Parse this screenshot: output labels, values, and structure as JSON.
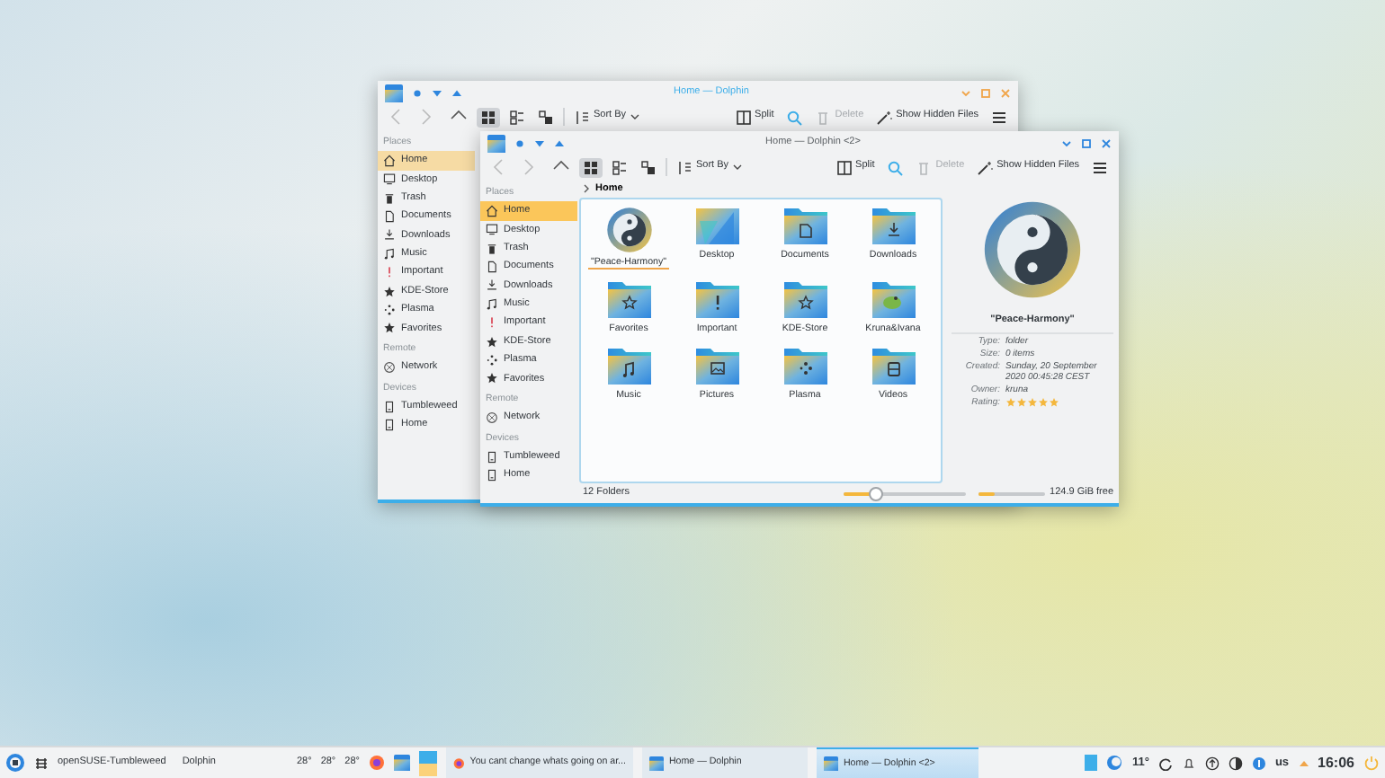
{
  "back_window": {
    "title": "Home — Dolphin",
    "toolbar": {
      "nav": [
        {
          "disabled": true
        },
        {
          "disabled": true
        },
        {
          "disabled": false
        }
      ],
      "view_modes": [
        {
          "selected": true
        },
        {
          "selected": false
        },
        {
          "selected": false
        }
      ],
      "sort": "Sort By",
      "split": "Split",
      "delete": {
        "label": "Delete",
        "disabled": true
      },
      "hidden_files": "Show Hidden Files"
    },
    "sidebar": [
      {
        "heading": "Places",
        "items": [
          {
            "label": "Home",
            "selected": true
          },
          {
            "label": "Desktop",
            "selected": false
          },
          {
            "label": "Trash",
            "selected": false
          },
          {
            "label": "Documents",
            "selected": false
          },
          {
            "label": "Downloads",
            "selected": false
          },
          {
            "label": "Music",
            "selected": false
          },
          {
            "label": "Important",
            "selected": false
          },
          {
            "label": "KDE-Store",
            "selected": false
          },
          {
            "label": "Plasma",
            "selected": false
          },
          {
            "label": "Favorites",
            "selected": false
          }
        ]
      },
      {
        "heading": "Remote",
        "items": [
          {
            "label": "Network",
            "selected": false
          }
        ]
      },
      {
        "heading": "Devices",
        "items": [
          {
            "label": "Tumbleweed",
            "selected": false
          },
          {
            "label": "Home",
            "selected": false
          }
        ]
      }
    ]
  },
  "front_window": {
    "title": "Home — Dolphin <2>",
    "toolbar": {
      "nav": [
        {
          "disabled": true
        },
        {
          "disabled": true
        },
        {
          "disabled": false
        }
      ],
      "view_modes": [
        {
          "selected": true
        },
        {
          "selected": false
        },
        {
          "selected": false
        }
      ],
      "sort": "Sort By",
      "split": "Split",
      "delete": {
        "label": "Delete",
        "disabled": true
      },
      "hidden_files": "Show Hidden Files"
    },
    "sidebar": [
      {
        "heading": "Places",
        "items": [
          {
            "label": "Home",
            "selected": true
          },
          {
            "label": "Desktop",
            "selected": false
          },
          {
            "label": "Trash",
            "selected": false
          },
          {
            "label": "Documents",
            "selected": false
          },
          {
            "label": "Downloads",
            "selected": false
          },
          {
            "label": "Music",
            "selected": false
          },
          {
            "label": "Important",
            "selected": false
          },
          {
            "label": "KDE-Store",
            "selected": false
          },
          {
            "label": "Plasma",
            "selected": false
          },
          {
            "label": "Favorites",
            "selected": false
          }
        ]
      },
      {
        "heading": "Remote",
        "items": [
          {
            "label": "Network",
            "selected": false
          }
        ]
      },
      {
        "heading": "Devices",
        "items": [
          {
            "label": "Tumbleweed",
            "selected": false
          },
          {
            "label": "Home",
            "selected": false
          }
        ]
      }
    ],
    "breadcrumb": "Home",
    "items": [
      {
        "label": "\"Peace-Harmony\"",
        "kind": "emblem",
        "selected": true
      },
      {
        "label": "Desktop",
        "kind": "image",
        "selected": false
      },
      {
        "label": "Documents",
        "kind": "folder",
        "selected": false
      },
      {
        "label": "Downloads",
        "kind": "folder",
        "selected": false
      },
      {
        "label": "Favorites",
        "kind": "folder",
        "selected": false
      },
      {
        "label": "Important",
        "kind": "folder",
        "selected": false
      },
      {
        "label": "KDE-Store",
        "kind": "folder",
        "selected": false
      },
      {
        "label": "Kruna&Ivana",
        "kind": "folder",
        "selected": false
      },
      {
        "label": "Music",
        "kind": "folder",
        "selected": false
      },
      {
        "label": "Pictures",
        "kind": "folder",
        "selected": false
      },
      {
        "label": "Plasma",
        "kind": "folder",
        "selected": false
      },
      {
        "label": "Videos",
        "kind": "folder",
        "selected": false
      }
    ],
    "info_panel": {
      "name": "\"Peace-Harmony\"",
      "fields": [
        {
          "label": "Type:",
          "value": "folder"
        },
        {
          "label": "Size:",
          "value": "0 items"
        },
        {
          "label": "Created:",
          "value": "Sunday, 20 September 2020 00:45:28 CEST"
        },
        {
          "label": "Owner:",
          "value": "kruna"
        }
      ],
      "rating": {
        "label": "Rating:",
        "stars": 5
      }
    },
    "status_bar": {
      "summary": "12 Folders",
      "zoom": {
        "level": 0.27
      },
      "free_space": {
        "level": 0.25,
        "text": "124.9 GiB free"
      }
    }
  },
  "taskbar": {
    "launcher_label": "openSUSE-Tumbleweed",
    "app_menu": "Dolphin",
    "weather": [
      "28°",
      "28°",
      "28°"
    ],
    "tasks": [
      {
        "label": "You cant change whats going on ar...",
        "selected": false
      },
      {
        "label": "Home — Dolphin",
        "selected": false
      },
      {
        "label": "Home — Dolphin <2>",
        "selected": true
      }
    ],
    "temperature": "11°",
    "keyboard_layout": "us",
    "clock": "16:06"
  }
}
